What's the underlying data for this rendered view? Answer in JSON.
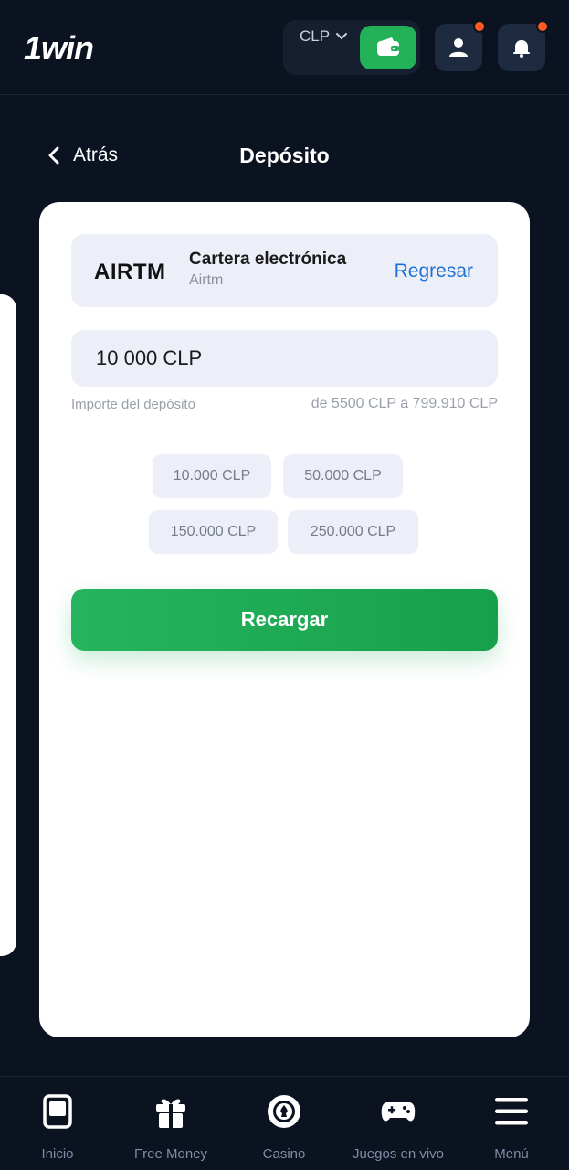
{
  "header": {
    "logo": "1win",
    "currency": "CLP"
  },
  "titlebar": {
    "back_label": "Atrás",
    "title": "Depósito"
  },
  "payment_method": {
    "logo_text": "AIRTM",
    "name": "Cartera electrónica",
    "provider": "Airtm",
    "change_label": "Regresar"
  },
  "amount": {
    "value": "10 000 CLP",
    "label": "Importe del depósito",
    "range": "de 5500 CLP a 799.910 CLP"
  },
  "quick_amounts": [
    "10.000 CLP",
    "50.000 CLP",
    "150.000 CLP",
    "250.000 CLP"
  ],
  "submit_label": "Recargar",
  "bottom_nav": [
    {
      "label": "Inicio",
      "icon": "home-icon"
    },
    {
      "label": "Free Money",
      "icon": "gift-icon"
    },
    {
      "label": "Casino",
      "icon": "casino-chip-icon"
    },
    {
      "label": "Juegos en vivo",
      "icon": "gamepad-icon"
    },
    {
      "label": "Menú",
      "icon": "menu-icon"
    }
  ],
  "colors": {
    "background": "#0b1220",
    "accent_green": "#22b157",
    "link_blue": "#1e73d8",
    "notification": "#ff5a1f"
  }
}
